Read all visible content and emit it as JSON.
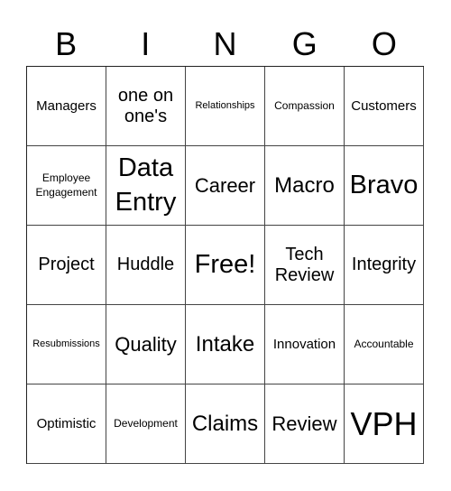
{
  "header": {
    "letters": [
      "B",
      "I",
      "N",
      "G",
      "O"
    ]
  },
  "cells": [
    [
      "Managers",
      "one on one's",
      "Relationships",
      "Compassion",
      "Customers"
    ],
    [
      "Employee Engagement",
      "Data Entry",
      "Career",
      "Macro",
      "Bravo"
    ],
    [
      "Project",
      "Huddle",
      "Free!",
      "Tech Review",
      "Integrity"
    ],
    [
      "Resubmissions",
      "Quality",
      "Intake",
      "Innovation",
      "Accountable"
    ],
    [
      "Optimistic",
      "Development",
      "Claims",
      "Review",
      "VPH"
    ]
  ]
}
